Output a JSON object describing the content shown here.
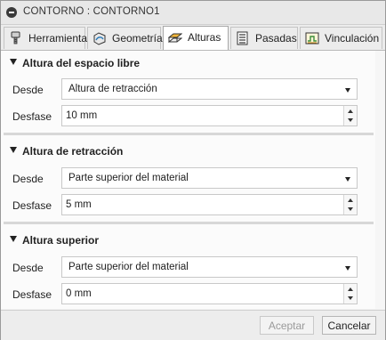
{
  "window": {
    "title": "CONTORNO : CONTORNO1"
  },
  "tabs": [
    {
      "label": "Herramienta",
      "icon": "tool-icon"
    },
    {
      "label": "Geometría",
      "icon": "geometry-icon"
    },
    {
      "label": "Alturas",
      "icon": "heights-icon",
      "active": true
    },
    {
      "label": "Pasadas",
      "icon": "passes-icon"
    },
    {
      "label": "Vinculación",
      "icon": "linking-icon"
    }
  ],
  "sections": [
    {
      "title": "Altura del espacio libre",
      "desde_label": "Desde",
      "desde_value": "Altura de retracción",
      "desfase_label": "Desfase",
      "desfase_value": "10 mm"
    },
    {
      "title": "Altura de retracción",
      "desde_label": "Desde",
      "desde_value": "Parte superior del material",
      "desfase_label": "Desfase",
      "desfase_value": "5 mm"
    },
    {
      "title": "Altura superior",
      "desde_label": "Desde",
      "desde_value": "Parte superior del material",
      "desfase_label": "Desfase",
      "desfase_value": "0 mm"
    }
  ],
  "footer": {
    "accept_label": "Aceptar",
    "cancel_label": "Cancelar"
  },
  "colors": {
    "title_bar": "#e8e8e8",
    "active_tab": "#ffffff",
    "section_divider": "#d7d7d7",
    "disabled_text": "#9a9a9a"
  }
}
